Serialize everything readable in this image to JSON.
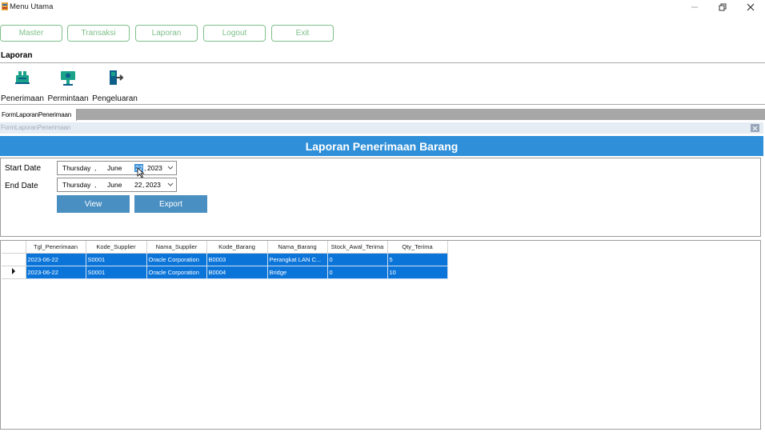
{
  "window": {
    "title": "Menu Utama"
  },
  "menu": {
    "buttons": [
      {
        "label": "Master"
      },
      {
        "label": "Transaksi"
      },
      {
        "label": "Laporan"
      },
      {
        "label": "Logout"
      },
      {
        "label": "Exit"
      }
    ]
  },
  "section": {
    "label": "Laporan"
  },
  "toolbar": {
    "items": [
      {
        "label": "Penerimaan",
        "icon": "receiving-icon"
      },
      {
        "label": "Permintaan",
        "icon": "request-icon"
      },
      {
        "label": "Pengeluaran",
        "icon": "outgoing-icon"
      }
    ]
  },
  "tab": {
    "label": "FormLaporanPenerimaan"
  },
  "child": {
    "title": "FormLaporanPenerimaan"
  },
  "report": {
    "header": "Laporan Penerimaan Barang",
    "start_label": "Start Date",
    "end_label": "End Date",
    "start": {
      "weekday": "Thursday",
      "month": "June",
      "day": "22",
      "year": "2023"
    },
    "end": {
      "weekday": "Thursday",
      "month": "June",
      "day": "22",
      "year": "2023"
    },
    "view_label": "View",
    "export_label": "Export"
  },
  "grid": {
    "columns": [
      "Tgl_Penerimaan",
      "Kode_Supplier",
      "Nama_Supplier",
      "Kode_Barang",
      "Nama_Barang",
      "Stock_Awal_Terima",
      "Qty_Terima"
    ],
    "rows": [
      [
        "2023-06-22",
        "S0001",
        "Oracle Corporation",
        "B0003",
        "Perangkat LAN C...",
        "0",
        "5"
      ],
      [
        "2023-06-22",
        "S0001",
        "Oracle Corporation",
        "B0004",
        "Bridge",
        "0",
        "10"
      ]
    ]
  },
  "colors": {
    "accent_green": "#7fbf8a",
    "header_blue": "#2f8fd8",
    "button_blue": "#4a8fc2",
    "selection_blue": "#0a74d9"
  }
}
